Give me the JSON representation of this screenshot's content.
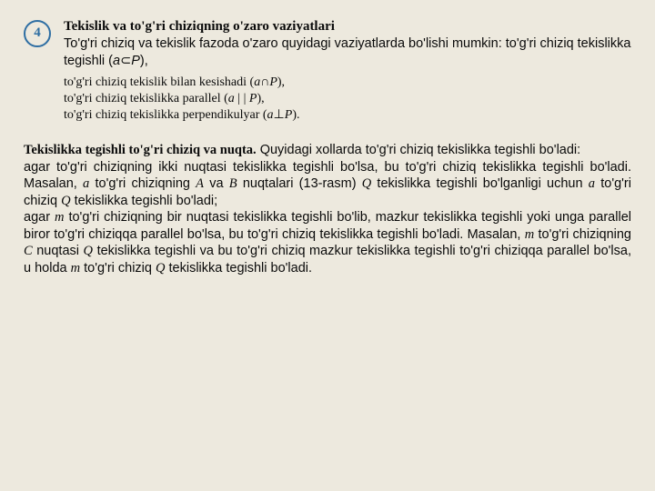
{
  "section": {
    "number": "4",
    "title": "Tekislik va to'g'ri chiziqning o'zaro vaziyatlari",
    "desc": "To'g'ri chiziq va tekislik fazoda o'zaro quyidagi vaziyatlarda bo'lishi mumkin: to'g'ri chiziq tekislikka tegishli (",
    "desc_sym_a": "a",
    "desc_sub_op": "⊂",
    "desc_sym_P": "P",
    "desc_tail": "),",
    "sub1_text": "to'g'ri chiziq tekislik bilan kesishadi (",
    "sub1_a": "a",
    "sub1_op": "∩",
    "sub1_P": "P",
    "sub1_tail": "),",
    "sub2_text": "to'g'ri chiziq tekislikka parallel (",
    "sub2_a": "a",
    "sub2_op": " | | ",
    "sub2_P": "P",
    "sub2_tail": "),",
    "sub3_text": "to'g'ri chiziq tekislikka perpendikulyar (",
    "sub3_a": "a",
    "sub3_op": "⊥",
    "sub3_P": "P",
    "sub3_tail": ")."
  },
  "para": {
    "title": "Tekislikka tegishli to'g'ri chiziq va nuqta.",
    "lead": " Quyidagi xollarda to'g'ri chiziq tekislikka tegishli bo'ladi:",
    "p1a": "agar to'g'ri chiziqning ikki nuqtasi tekislikka tegishli bo'lsa, bu to'g'ri chiziq tekislikka tegishli bo'ladi. Masalan, ",
    "p1_a": "a",
    "p1b": " to'g'ri chiziqning ",
    "p1_A": "A",
    "p1c": " va ",
    "p1_B": "B",
    "p1d": " nuqtalari (13-rasm) ",
    "p1_Q": "Q",
    "p1e": " tekislikka tegishli bo'lganligi uchun ",
    "p1_a2": "a",
    "p1f": " to'g'ri chiziq ",
    "p1_Q2": "Q",
    "p1g": " tekislikka tegishli bo'ladi;",
    "p2a": "agar ",
    "p2_m": "m",
    "p2b": " to'g'ri chiziqning bir nuqtasi tekislikka tegishli bo'lib, mazkur tekislikka tegishli yoki unga parallel biror to'g'ri chiziqqa parallel bo'lsa, bu to'g'ri chiziq tekislikka tegishli bo'ladi. Masalan, ",
    "p2_m2": "m",
    "p2c": " to'g'ri chiziqning ",
    "p2_C": "C",
    "p2d": " nuqtasi ",
    "p2_Q": "Q",
    "p2e": " tekislikka tegishli va bu to'g'ri chiziq mazkur tekislikka tegishli to'g'ri chiziqqa parallel bo'lsa, u holda ",
    "p2_m3": "m",
    "p2f": " to'g'ri chiziq ",
    "p2_Q2": "Q",
    "p2g": " tekislikka tegishli bo'ladi."
  }
}
